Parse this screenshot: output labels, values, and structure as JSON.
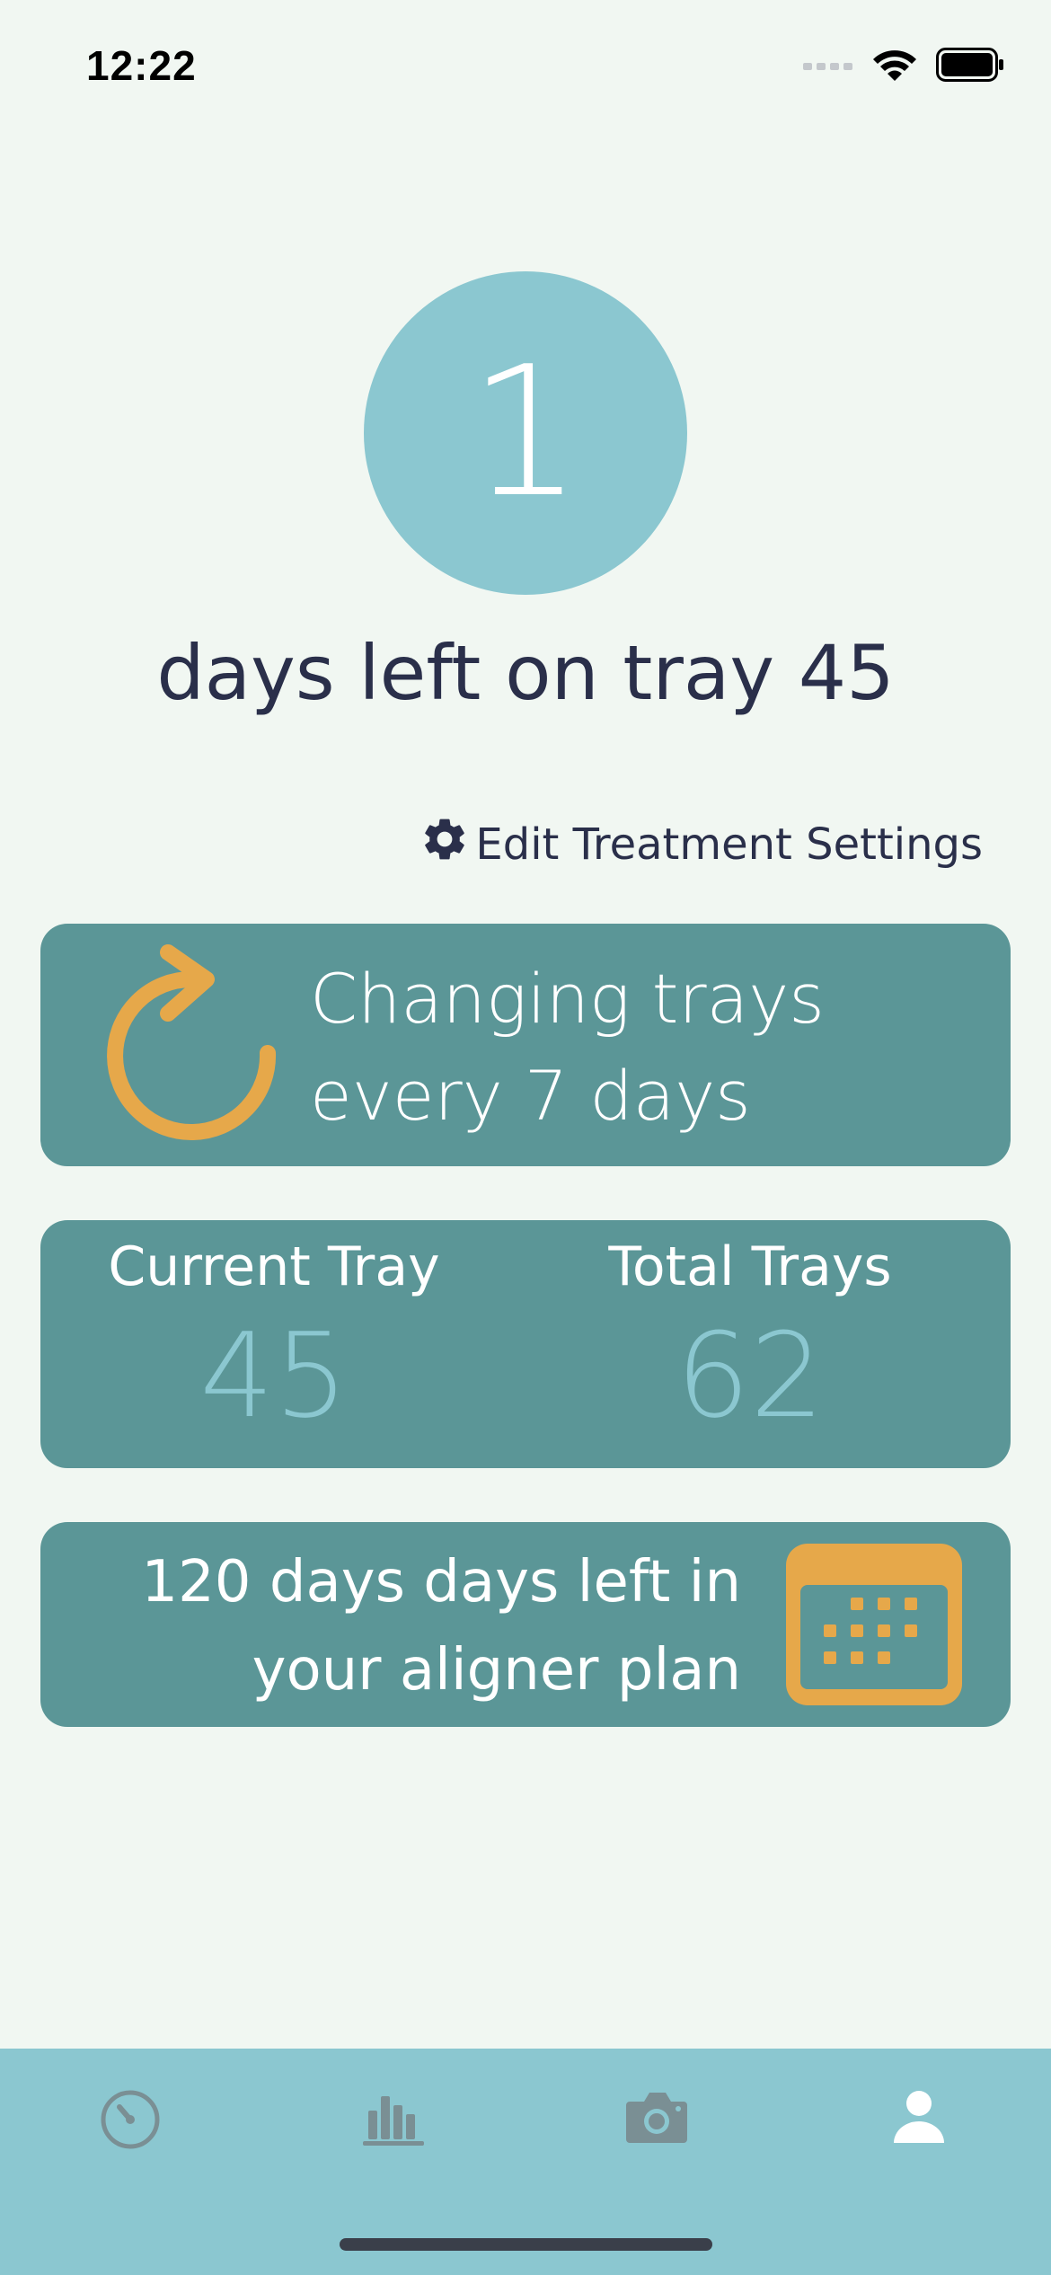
{
  "status_bar": {
    "time": "12:22",
    "icons": [
      "signal-icon",
      "wifi-icon",
      "battery-icon"
    ]
  },
  "countdown": {
    "value": "1",
    "caption": "days left on tray 45"
  },
  "edit_settings": {
    "label": "Edit Treatment Settings",
    "icon": "gear-icon"
  },
  "interval_card": {
    "line1": "Changing trays",
    "line2": "every 7 days",
    "icon": "refresh-arrow-icon"
  },
  "trays_card": {
    "current_label": "Current Tray",
    "current_value": "45",
    "total_label": "Total Trays",
    "total_value": "62"
  },
  "plan_card": {
    "line1": "120 days days left in",
    "line2": "your aligner plan",
    "icon": "calendar-icon"
  },
  "tab_bar": {
    "tabs": [
      {
        "icon": "timer-icon",
        "active": false
      },
      {
        "icon": "stats-icon",
        "active": false
      },
      {
        "icon": "camera-icon",
        "active": false
      },
      {
        "icon": "profile-icon",
        "active": true
      }
    ]
  },
  "colors": {
    "background": "#f1f7f2",
    "accent_light": "#8bc7d0",
    "card": "#5b9697",
    "orange": "#e6a84a",
    "text_dark": "#2a2f4a",
    "tab_inactive": "#7a8f94",
    "tab_active": "#ffffff"
  }
}
